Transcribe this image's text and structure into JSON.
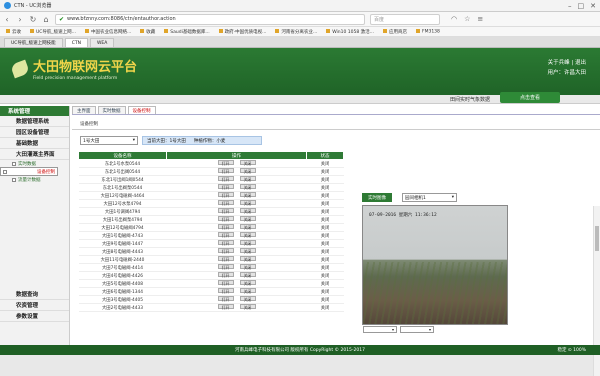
{
  "browser": {
    "title": "CTN - UC浏览器",
    "url": "www.bfznny.com:8086/ctn/entauthor.action",
    "search_placeholder": "百度",
    "bookmarks": [
      "云收",
      "UC导航_极速上网...",
      "中国农业信息网络...",
      "收藏",
      "Saudi基础数据库...",
      "政府·中国优质电视...",
      "河南省分离农业...",
      "Win10 1058 激活...",
      "应用商店",
      "FM3138"
    ],
    "tabs": [
      "UC导航_极速上网技能",
      "CTN",
      "WEA"
    ]
  },
  "site": {
    "title": "大田物联网云平台",
    "subtitle": "Field precision management platform",
    "user_label": "用户：许昌大田",
    "about": "关于兵峰 | 退出"
  },
  "bar": {
    "weather_label": "田间实时气象数据",
    "query_btn": "点击查看"
  },
  "sidebar": {
    "head": "系统管理",
    "items": [
      "数据管理系统",
      "园区设备管理",
      "基础数据",
      "大田灌溉主界面"
    ],
    "subitems": [
      "实时数据",
      "设备控制",
      "流量计数据"
    ],
    "bottom": [
      "数据查询",
      "农资管理",
      "参数设置"
    ]
  },
  "content": {
    "tabs": [
      "主界面",
      "实时数据",
      "设备控制"
    ],
    "subtab": "设备控制",
    "select1": "1号大田",
    "info1": "当前大田：1号大田",
    "info2": "种植作物：小麦",
    "columns": [
      "设备名称",
      "操作",
      "状态"
    ],
    "open": "打开",
    "close": "关闭",
    "rows": [
      [
        "东北1号水泵0544",
        "关闭"
      ],
      [
        "东北1号出阀0544",
        "关闭"
      ],
      [
        "东北1号出阀1阀0544",
        "关闭"
      ],
      [
        "东北1号出阀泵0544",
        "关闭"
      ],
      [
        "大田12号电磁阀-4464",
        "关闭"
      ],
      [
        "大田12号水泵4794",
        "关闭"
      ],
      [
        "大田1号调阀4794",
        "关闭"
      ],
      [
        "大田1号出阀泵4794",
        "关闭"
      ],
      [
        "大田12号电磁阀4794",
        "关闭"
      ],
      [
        "大田1号电磁阀-4743",
        "关闭"
      ],
      [
        "大田9号电磁阀-1447",
        "关闭"
      ],
      [
        "大田8号电磁阀-4443",
        "关闭"
      ],
      [
        "大田11号电磁阀-2440",
        "关闭"
      ],
      [
        "大田7号电磁阀-4414",
        "关闭"
      ],
      [
        "大田4号电磁阀-4426",
        "关闭"
      ],
      [
        "大田5号电磁阀-4408",
        "关闭"
      ],
      [
        "大田6号电磁阀-1344",
        "关闭"
      ],
      [
        "大田3号电磁阀-4405",
        "关闭"
      ],
      [
        "大田2号电磁阀-4433",
        "关闭"
      ]
    ],
    "cam_btn": "实时图像",
    "cam_sel": "园间相机1",
    "timestamp": "07-09-2016 星期六 11:36:12"
  },
  "footer": {
    "text": "河南兵峰电子科技有限公司 版权所有 CopyRight © 2015-2017",
    "right": "稳定 ⊙ 100%"
  }
}
